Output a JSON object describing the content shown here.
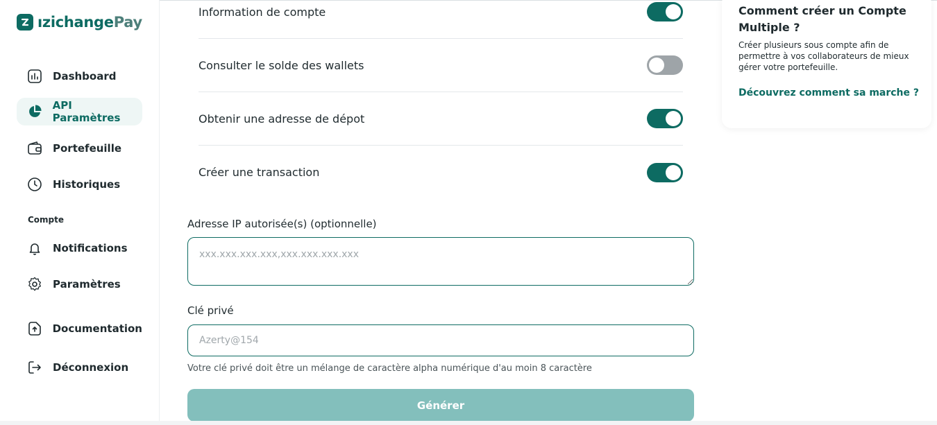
{
  "brand": {
    "name_main": "ızichange",
    "name_pay": "Pay",
    "color": "#0d6b62"
  },
  "sidebar": {
    "items": [
      {
        "label": "Dashboard",
        "icon": "chart-bars-icon"
      },
      {
        "label": "API Paramètres",
        "icon": "pie-chart-icon",
        "active": true
      },
      {
        "label": "Portefeuille",
        "icon": "wallet-icon"
      },
      {
        "label": "Historiques",
        "icon": "clock-icon"
      }
    ],
    "section_label": "Compte",
    "account_items": [
      {
        "label": "Notifications",
        "icon": "bell-icon"
      },
      {
        "label": "Paramètres",
        "icon": "gear-icon"
      },
      {
        "label": "Documentation",
        "icon": "document-upload-icon"
      },
      {
        "label": "Déconnexion",
        "icon": "logout-icon"
      }
    ]
  },
  "permissions": [
    {
      "label": "Information de compte",
      "enabled": true
    },
    {
      "label": "Consulter le solde des wallets",
      "enabled": false
    },
    {
      "label": "Obtenir une adresse de dépot",
      "enabled": true
    },
    {
      "label": "Créer une transaction",
      "enabled": true
    }
  ],
  "form": {
    "ip_label": "Adresse IP autorisée(s) (optionnelle)",
    "ip_placeholder": "xxx.xxx.xxx.xxx,xxx.xxx.xxx.xxx",
    "key_label": "Clé privé",
    "key_placeholder": "Azerty@154",
    "key_hint": "Votre clé privé doit être un mélange de caractère alpha numérique d'au moin 8 caractère",
    "submit_label": "Générer"
  },
  "help_card": {
    "title": "Comment créer un Compte Multiple ?",
    "text": "Créer plusieurs sous compte afin de permettre à vos collaborateurs de mieux gérer votre portefeuille.",
    "link": "Découvrez comment sa marche ?"
  }
}
